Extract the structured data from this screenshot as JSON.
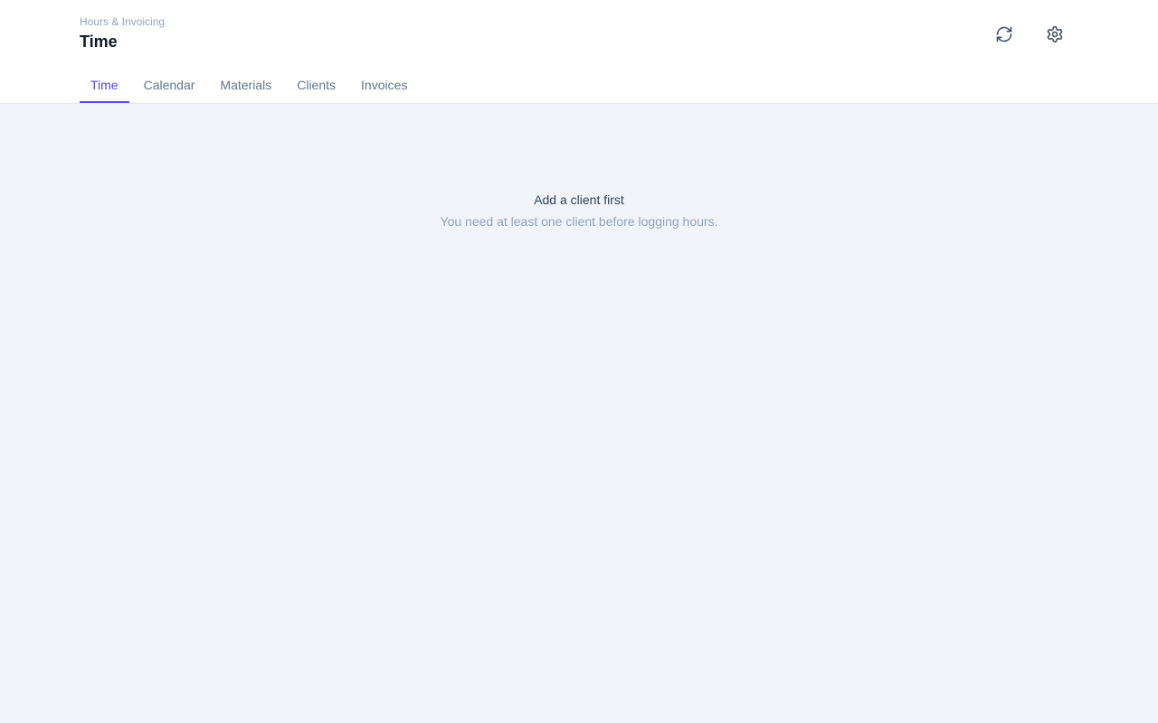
{
  "header": {
    "breadcrumb": "Hours & Invoicing",
    "title": "Time",
    "refresh_icon": "refresh-icon",
    "settings_icon": "gear-icon"
  },
  "tabs": [
    {
      "label": "Time",
      "active": true
    },
    {
      "label": "Calendar",
      "active": false
    },
    {
      "label": "Materials",
      "active": false
    },
    {
      "label": "Clients",
      "active": false
    },
    {
      "label": "Invoices",
      "active": false
    }
  ],
  "empty_state": {
    "title": "Add a client first",
    "description": "You need at least one client before logging hours."
  },
  "colors": {
    "accent": "#4f46e5",
    "background": "#f0f4f9",
    "header_bg": "#ffffff"
  }
}
